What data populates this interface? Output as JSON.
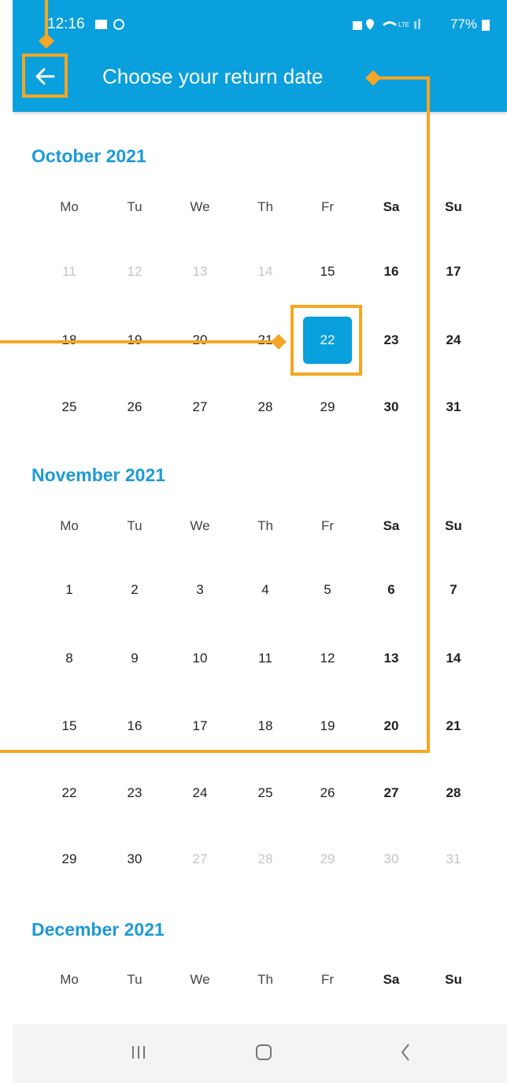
{
  "status_bar": {
    "time": "12:16",
    "battery": "77%"
  },
  "header": {
    "title": "Choose your return date"
  },
  "weekdays": [
    "Mo",
    "Tu",
    "We",
    "Th",
    "Fr",
    "Sa",
    "Su"
  ],
  "months": [
    {
      "name": "October 2021",
      "weeks": [
        [
          "11",
          "12",
          "13",
          "14",
          "15",
          "16",
          "17"
        ],
        [
          "18",
          "19",
          "20",
          "21",
          "22",
          "23",
          "24"
        ],
        [
          "25",
          "26",
          "27",
          "28",
          "29",
          "30",
          "31"
        ]
      ]
    },
    {
      "name": "November 2021",
      "weeks": [
        [
          "1",
          "2",
          "3",
          "4",
          "5",
          "6",
          "7"
        ],
        [
          "8",
          "9",
          "10",
          "11",
          "12",
          "13",
          "14"
        ],
        [
          "15",
          "16",
          "17",
          "18",
          "19",
          "20",
          "21"
        ],
        [
          "22",
          "23",
          "24",
          "25",
          "26",
          "27",
          "28"
        ],
        [
          "29",
          "30",
          "27",
          "28",
          "29",
          "30",
          "31"
        ]
      ]
    },
    {
      "name": "December 2021",
      "weeks": []
    }
  ],
  "selected_date": "22",
  "colors": {
    "primary": "#0a9fdd",
    "annotation": "#f5a623",
    "month_title": "#1e9ad6"
  }
}
